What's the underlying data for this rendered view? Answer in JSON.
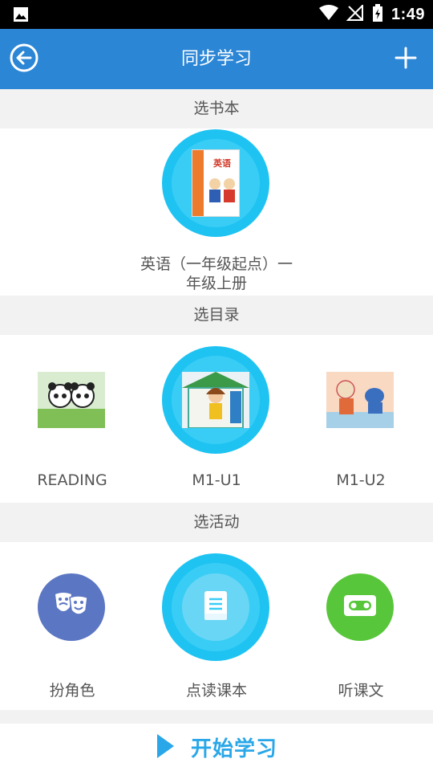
{
  "status_bar": {
    "time": "1:49"
  },
  "app_bar": {
    "title": "同步学习"
  },
  "sections": {
    "book": {
      "header": "选书本",
      "selected_book": {
        "cover_title": "英语",
        "label": "英语（一年级起点）一年级上册"
      }
    },
    "catalog": {
      "header": "选目录",
      "items": [
        {
          "label": "READING"
        },
        {
          "label": "M1-U1",
          "selected": true
        },
        {
          "label": "M1-U2"
        }
      ]
    },
    "activity": {
      "header": "选活动",
      "items": [
        {
          "label": "扮角色",
          "icon": "drama-masks-icon",
          "color": "#5b76c2"
        },
        {
          "label": "点读课本",
          "icon": "book-icon",
          "color": "#39cdf5",
          "selected": true
        },
        {
          "label": "听课文",
          "icon": "cassette-icon",
          "color": "#58c63a"
        }
      ]
    }
  },
  "bottom": {
    "start_label": "开始学习"
  },
  "colors": {
    "accent": "#2b86d6",
    "ring": "#1ec3f2",
    "start": "#2aa7e8"
  }
}
